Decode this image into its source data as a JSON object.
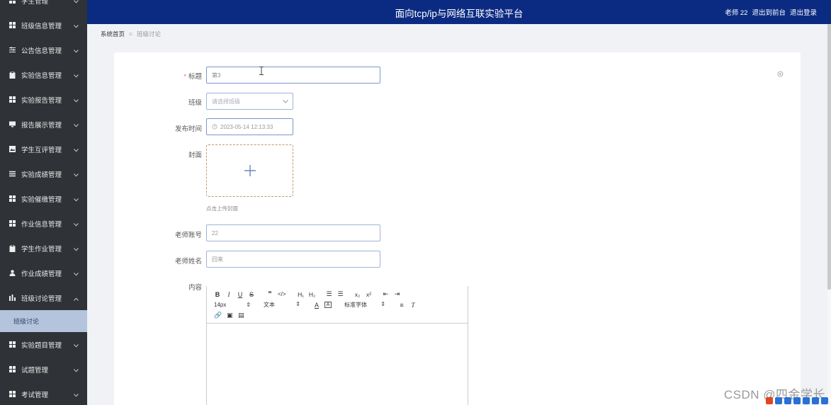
{
  "header": {
    "title": "面向tcp/ip与网络互联实验平台",
    "user": "老师 22",
    "to_frontend": "退出到前台",
    "logout": "退出登录"
  },
  "sidebar": {
    "items": [
      {
        "label": "学生管理",
        "icon": "grid-icon"
      },
      {
        "label": "班级信息管理",
        "icon": "grid-icon"
      },
      {
        "label": "公告信息管理",
        "icon": "sliders-icon"
      },
      {
        "label": "实验信息管理",
        "icon": "clipboard-icon"
      },
      {
        "label": "实验报告管理",
        "icon": "grid-icon"
      },
      {
        "label": "报告展示管理",
        "icon": "monitor-icon"
      },
      {
        "label": "学生互评管理",
        "icon": "image-icon"
      },
      {
        "label": "实验成绩管理",
        "icon": "list-icon"
      },
      {
        "label": "实验催缴管理",
        "icon": "grid-icon"
      },
      {
        "label": "作业信息管理",
        "icon": "grid-icon"
      },
      {
        "label": "学生作业管理",
        "icon": "clipboard-icon"
      },
      {
        "label": "作业成绩管理",
        "icon": "user-icon"
      },
      {
        "label": "班级讨论管理",
        "icon": "chart-icon"
      },
      {
        "label": "实验题目管理",
        "icon": "grid-icon"
      },
      {
        "label": "试题管理",
        "icon": "grid-icon"
      },
      {
        "label": "考试管理",
        "icon": "grid-icon"
      }
    ],
    "sub_item": "班级讨论"
  },
  "breadcrumb": {
    "home": "系统首页",
    "current": "班级讨论"
  },
  "form": {
    "title_label": "标题",
    "title_value": "第3",
    "class_label": "班级",
    "class_placeholder": "请选择班级",
    "time_label": "发布时间",
    "time_value": "2023-05-14 12:13:33",
    "cover_label": "封面",
    "cover_hint": "点击上传封面",
    "teacher_account_label": "老师账号",
    "teacher_account_value": "22",
    "teacher_name_label": "老师姓名",
    "teacher_name_value": "回来",
    "content_label": "内容"
  },
  "editor": {
    "font_size": "14px",
    "paragraph": "文本",
    "font_family": "标准字体"
  },
  "watermark": "CSDN @四金学长",
  "colors": {
    "sidebar_bg": "#2f3337",
    "header_bg": "#0b2b82",
    "active_sub_bg": "#b3c4dc",
    "required": "#f56c6c"
  }
}
